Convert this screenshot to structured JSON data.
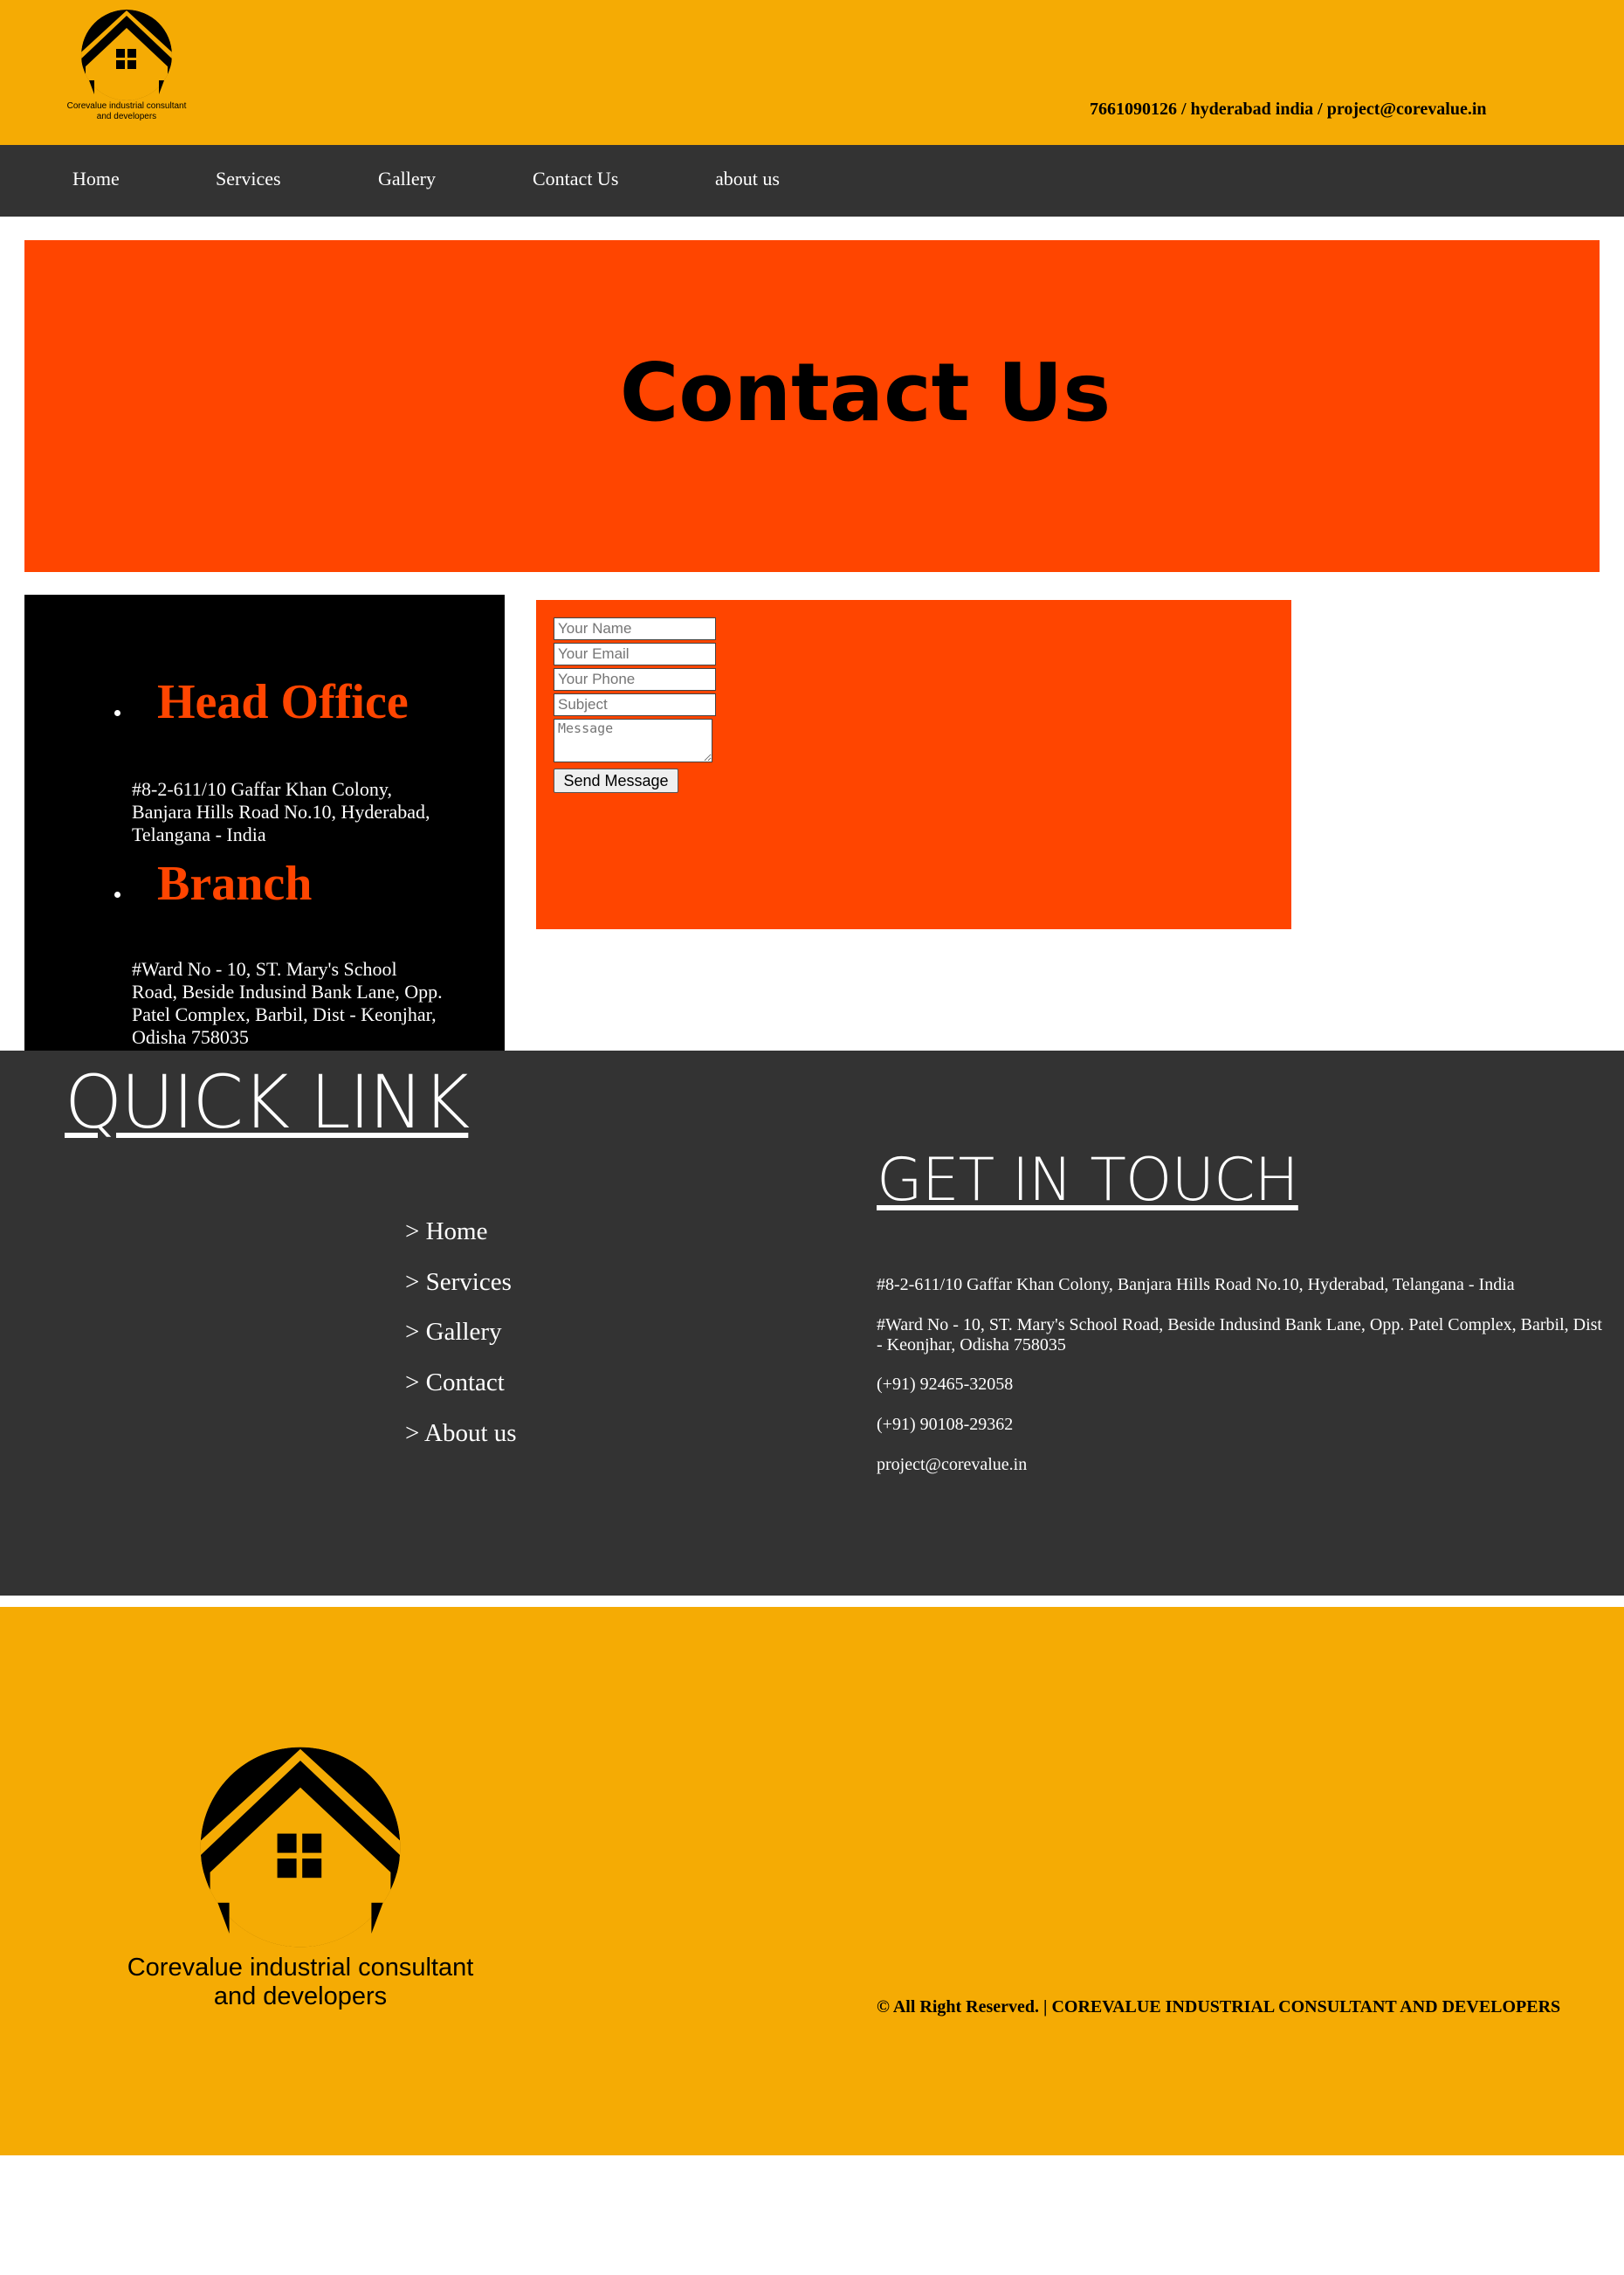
{
  "header": {
    "logo_text_line1": "Corevalue industrial consultant",
    "logo_text_line2": "and developers",
    "contact_line": "7661090126 / hyderabad india / project@corevalue.in"
  },
  "nav": {
    "items": [
      "Home",
      "Services",
      "Gallery",
      "Contact Us",
      "about us"
    ]
  },
  "banner": {
    "title": "Contact Us"
  },
  "offices": [
    {
      "heading": "Head Office",
      "address_lines": [
        "#8-2-611/10 Gaffar Khan Colony,",
        "Banjara Hills Road No.10, Hyderabad,",
        "Telangana - India"
      ]
    },
    {
      "heading": "Branch",
      "address_lines": [
        "#Ward No - 10, ST. Mary's School",
        "Road, Beside Indusind Bank Lane, Opp.",
        "Patel Complex, Barbil, Dist - Keonjhar,",
        "Odisha 758035"
      ]
    }
  ],
  "form": {
    "name_placeholder": "Your Name",
    "email_placeholder": "Your Email",
    "phone_placeholder": "Your Phone",
    "subject_placeholder": "Subject",
    "message_placeholder": "Message",
    "submit_label": "Send Message"
  },
  "footer": {
    "quick_link_title": "QUICK LINK",
    "quick_links": [
      "> Home",
      "> Services",
      "> Gallery",
      "> Contact",
      "> About us"
    ],
    "get_in_touch_title": "GET IN TOUCH",
    "contact_lines": [
      "#8-2-611/10 Gaffar Khan Colony, Banjara Hills Road No.10, Hyderabad, Telangana - India",
      "#Ward No - 10, ST. Mary's School Road, Beside Indusind Bank Lane, Opp. Patel Complex, Barbil, Dist - Keonjhar, Odisha 758035",
      "(+91) 92465-32058",
      "(+91) 90108-29362",
      "project@corevalue.in"
    ],
    "copyright": "© All Right Reserved. | COREVALUE INDUSTRIAL CONSULTANT AND DEVELOPERS"
  },
  "colors": {
    "header_yellow": "#f5ab04",
    "nav_dark": "#333333",
    "accent_orange": "#ff4500",
    "panel_black": "#000000"
  },
  "icons": [
    "house-logo-icon",
    "house-logo-large-icon"
  ]
}
